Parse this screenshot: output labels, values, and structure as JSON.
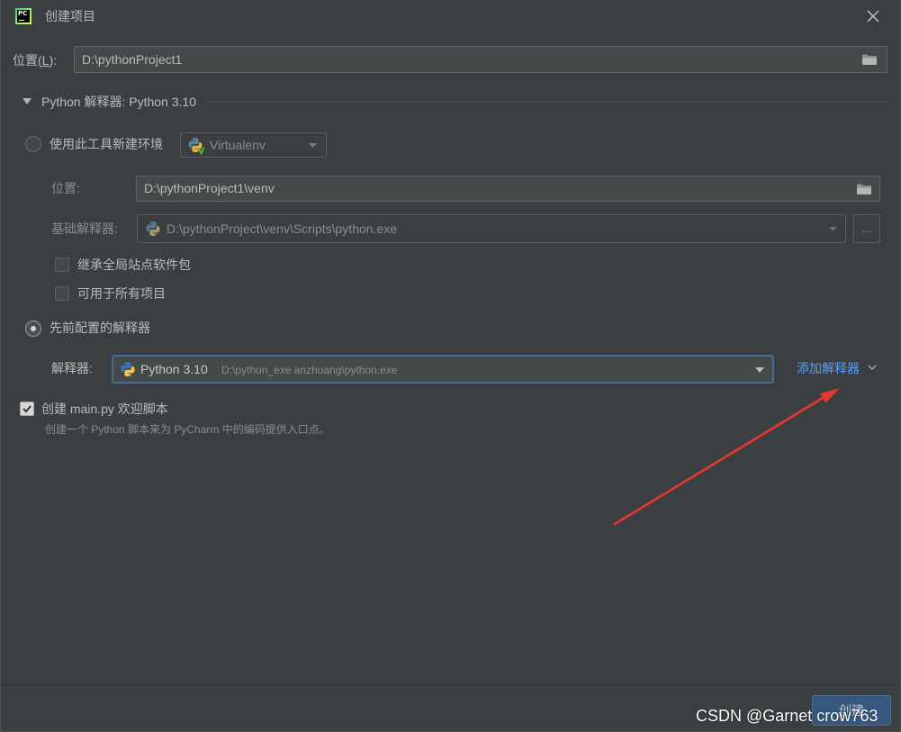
{
  "window": {
    "title": "创建项目",
    "logo_text": "PC"
  },
  "location": {
    "label_prefix": "位置(",
    "mnemonic": "L",
    "label_suffix": "):",
    "value": "D:\\pythonProject1"
  },
  "interpreter_section": {
    "title": "Python 解释器: Python 3.10",
    "expanded": true
  },
  "new_env": {
    "label": "使用此工具新建环境",
    "selected": false,
    "tool": "Virtualenv",
    "location_label": "位置:",
    "location_value": "D:\\pythonProject1\\venv",
    "base_label": "基础解释器:",
    "base_value": "D:\\pythonProject\\venv\\Scripts\\python.exe",
    "browse_label": "...",
    "inherit_label": "继承全局站点软件包",
    "inherit_checked": false,
    "all_projects_label": "可用于所有项目",
    "all_projects_checked": false
  },
  "existing": {
    "label": "先前配置的解释器",
    "selected": true,
    "interpreter_label": "解释器:",
    "interpreter_name": "Python 3.10",
    "interpreter_path": "D:\\python_exe anzhuang\\python.exe",
    "add_label": "添加解释器"
  },
  "welcome_script": {
    "label": "创建 main.py 欢迎脚本",
    "checked": true,
    "hint": "创建一个 Python 脚本来为 PyCharm 中的编码提供入口点。"
  },
  "footer": {
    "create_label": "创建"
  },
  "watermark": "CSDN @Garnet crow763",
  "icons": {
    "logo": "pycharm-logo",
    "close": "close-icon",
    "folder": "folder-icon",
    "python": "python-icon",
    "dropdown": "dropdown-arrow-icon",
    "expand": "triangle-down-icon",
    "chevron": "chevron-down-icon",
    "annotation": "red-arrow-annotation"
  },
  "colors": {
    "background": "#3c3f41",
    "text": "#bbbbbb",
    "muted": "#8c8c8c",
    "link": "#589df6",
    "focus": "#466d94",
    "primary_button": "#365880",
    "annotation": "#e8392e"
  }
}
